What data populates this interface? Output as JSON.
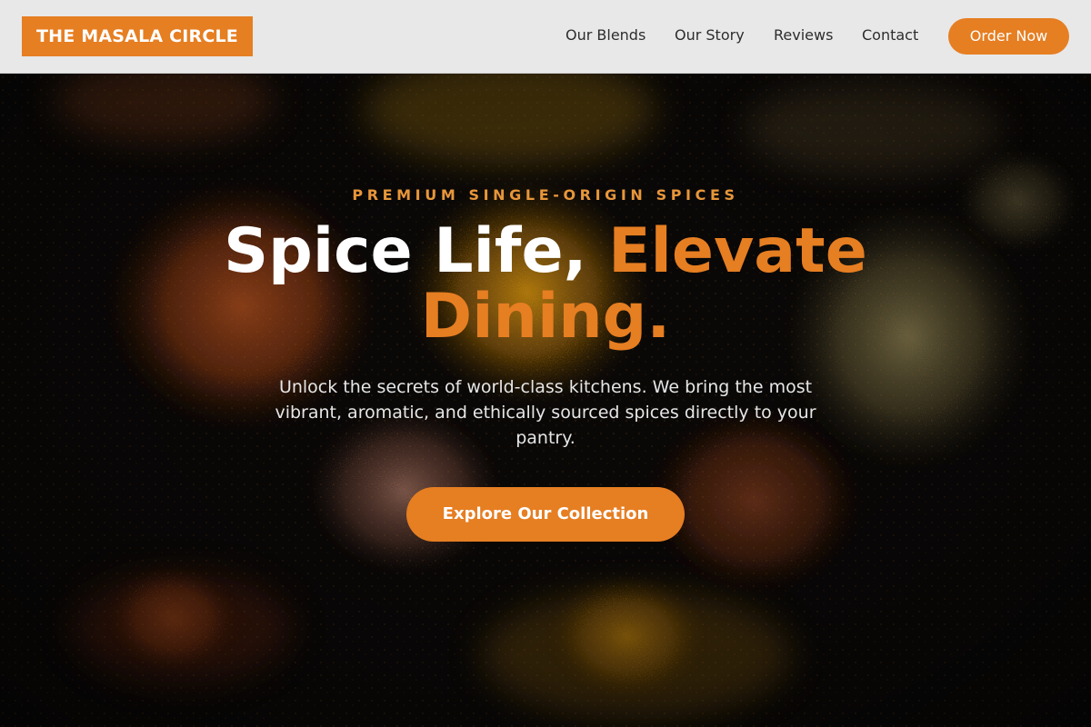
{
  "header": {
    "logo": "THE MASALA CIRCLE",
    "nav": [
      {
        "label": "Our Blends"
      },
      {
        "label": "Our Story"
      },
      {
        "label": "Reviews"
      },
      {
        "label": "Contact"
      }
    ],
    "order_button": "Order Now"
  },
  "hero": {
    "eyebrow": "PREMIUM SINGLE-ORIGIN SPICES",
    "headline_white": "Spice Life, ",
    "headline_accent": "Elevate Dining.",
    "subtext": "Unlock the secrets of world-class kitchens. We bring the most vibrant, aromatic, and ethically sourced spices directly to your pantry.",
    "cta_button": "Explore Our Collection",
    "background_description_icon": "spice-piles-photo"
  },
  "colors": {
    "accent": "#e67e22",
    "eyebrow": "#e8963a",
    "header_bg": "#e8e8e8",
    "hero_bg": "#0b0908",
    "nav_text": "#2d2d2d"
  }
}
